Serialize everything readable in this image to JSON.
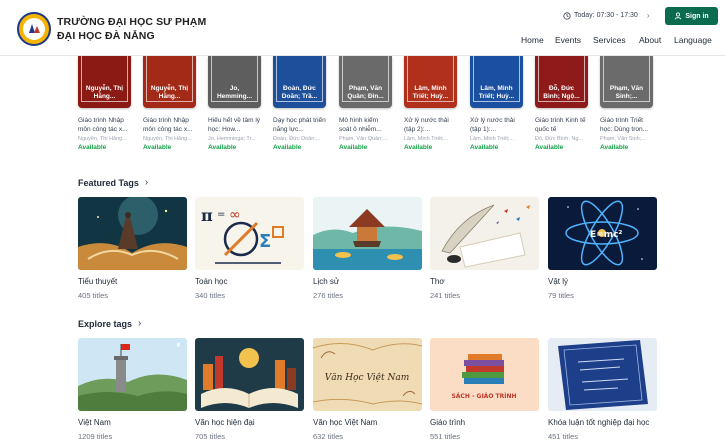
{
  "header": {
    "school_line1": "TRƯỜNG ĐẠI HỌC SƯ PHẠM",
    "school_line2": "ĐẠI HỌC ĐÀ NẴNG",
    "today": "Today: 07:30 - 17:30",
    "signin_label": "Sign in",
    "nav": [
      "Home",
      "Events",
      "Services",
      "About",
      "Language"
    ]
  },
  "books": [
    {
      "cover_author": "Nguyễn, Thị Hằng...",
      "title": "Giáo trình Nhập môn công tác x...",
      "author": "Nguyễn, Thị Hằng...",
      "status": "Available",
      "color": "#8b1a14"
    },
    {
      "cover_author": "Nguyễn, Thị Hằng...",
      "title": "Giáo trình Nhập môn công tác x...",
      "author": "Nguyễn, Thị Hằng...",
      "status": "Available",
      "color": "#a32a17"
    },
    {
      "cover_author": "Jo, Hemming...",
      "title": "Hiểu hết về tâm lý học: How...",
      "author": "Jo, Hemminga; Tr...",
      "status": "Available",
      "color": "#5e5e5e"
    },
    {
      "cover_author": "Đoàn, Đức Doãn; Trầ...",
      "title": "Dạy học phát triển năng lực...",
      "author": "Đoàn, Đức Doãn;...",
      "status": "Available",
      "color": "#1d4f9a"
    },
    {
      "cover_author": "Phạm, Văn Quân; Đin...",
      "title": "Mô hình kiểm soát ô nhiễm...",
      "author": "Phạm, Văn Quân;...",
      "status": "Available",
      "color": "#6a6a6a"
    },
    {
      "cover_author": "Lâm, Minh Triết; Huỳ...",
      "title": "Xử lý nước thải (tập 2):...",
      "author": "Lâm, Minh Triết;...",
      "status": "Available",
      "color": "#b0301c"
    },
    {
      "cover_author": "Lâm, Minh Triết; Huỳ...",
      "title": "Xử lý nước thải (tập 1):...",
      "author": "Lâm, Minh Triết;...",
      "status": "Available",
      "color": "#1b4fa0"
    },
    {
      "cover_author": "Đỗ, Đức Bình; Ngộ...",
      "title": "Giáo trình Kinh tế quốc tế",
      "author": "Đỗ, Đức Bình; Ng...",
      "status": "Available",
      "color": "#8e1a1a"
    },
    {
      "cover_author": "Phạm, Văn Sinh;...",
      "title": "Giáo trình Triết học: Dùng tron...",
      "author": "Phạm, Văn Sinh;...",
      "status": "Available",
      "color": "#6b6b6b"
    }
  ],
  "featured": {
    "title": "Featured Tags",
    "tiles": [
      {
        "name": "Tiểu thuyết",
        "count": "405 titles"
      },
      {
        "name": "Toán học",
        "count": "340 titles"
      },
      {
        "name": "Lịch sử",
        "count": "276 titles"
      },
      {
        "name": "Thơ",
        "count": "241 titles"
      },
      {
        "name": "Vật lý",
        "count": "79 titles"
      }
    ]
  },
  "explore": {
    "title": "Explore tags",
    "tiles": [
      {
        "name": "Việt Nam",
        "count": "1209 titles"
      },
      {
        "name": "Văn học hiện đại",
        "count": "705 titles"
      },
      {
        "name": "Văn học Việt Nam",
        "count": "632 titles"
      },
      {
        "name": "Giáo trình",
        "count": "551 titles"
      },
      {
        "name": "Khóa luận tốt nghiệp đại học",
        "count": "451 titles"
      }
    ]
  },
  "art_text": {
    "vhvn": "Văn Học Việt Nam",
    "sach": "SÁCH - GIÁO TRÌNH",
    "emc": "E=mc²"
  }
}
